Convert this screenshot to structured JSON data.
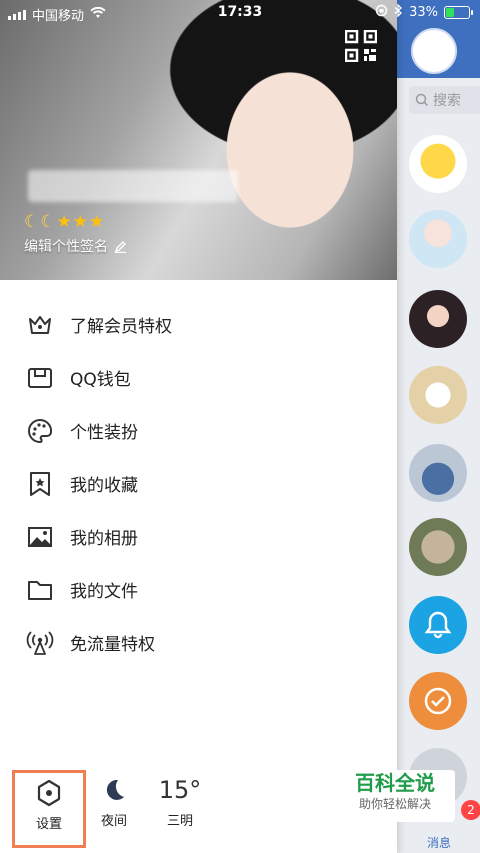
{
  "status_bar": {
    "carrier": "中国移动",
    "time": "17:33",
    "battery": "33%",
    "battery_level": 0.33
  },
  "drawer": {
    "signature": "编辑个性签名",
    "level": {
      "moons": 2,
      "stars": 3
    },
    "menu": [
      {
        "label": "了解会员特权",
        "icon": "crown-icon"
      },
      {
        "label": "QQ钱包",
        "icon": "wallet-icon"
      },
      {
        "label": "个性装扮",
        "icon": "palette-icon"
      },
      {
        "label": "我的收藏",
        "icon": "bookmark-star-icon"
      },
      {
        "label": "我的相册",
        "icon": "image-icon"
      },
      {
        "label": "我的文件",
        "icon": "folder-icon"
      },
      {
        "label": "免流量特权",
        "icon": "antenna-icon"
      }
    ],
    "bottom": {
      "settings_label": "设置",
      "night_label": "夜间",
      "weather_temp": "15°",
      "weather_city": "三明"
    }
  },
  "right_panel": {
    "search_label": "搜索",
    "message_tab": "消息",
    "badge": "2"
  },
  "watermark": {
    "title": "百科全说",
    "subtitle": "助你轻松解决"
  },
  "colors": {
    "accent": "#3f6fbf",
    "highlight_border": "#ef7f52",
    "watermark_green": "#1e9c4a"
  }
}
